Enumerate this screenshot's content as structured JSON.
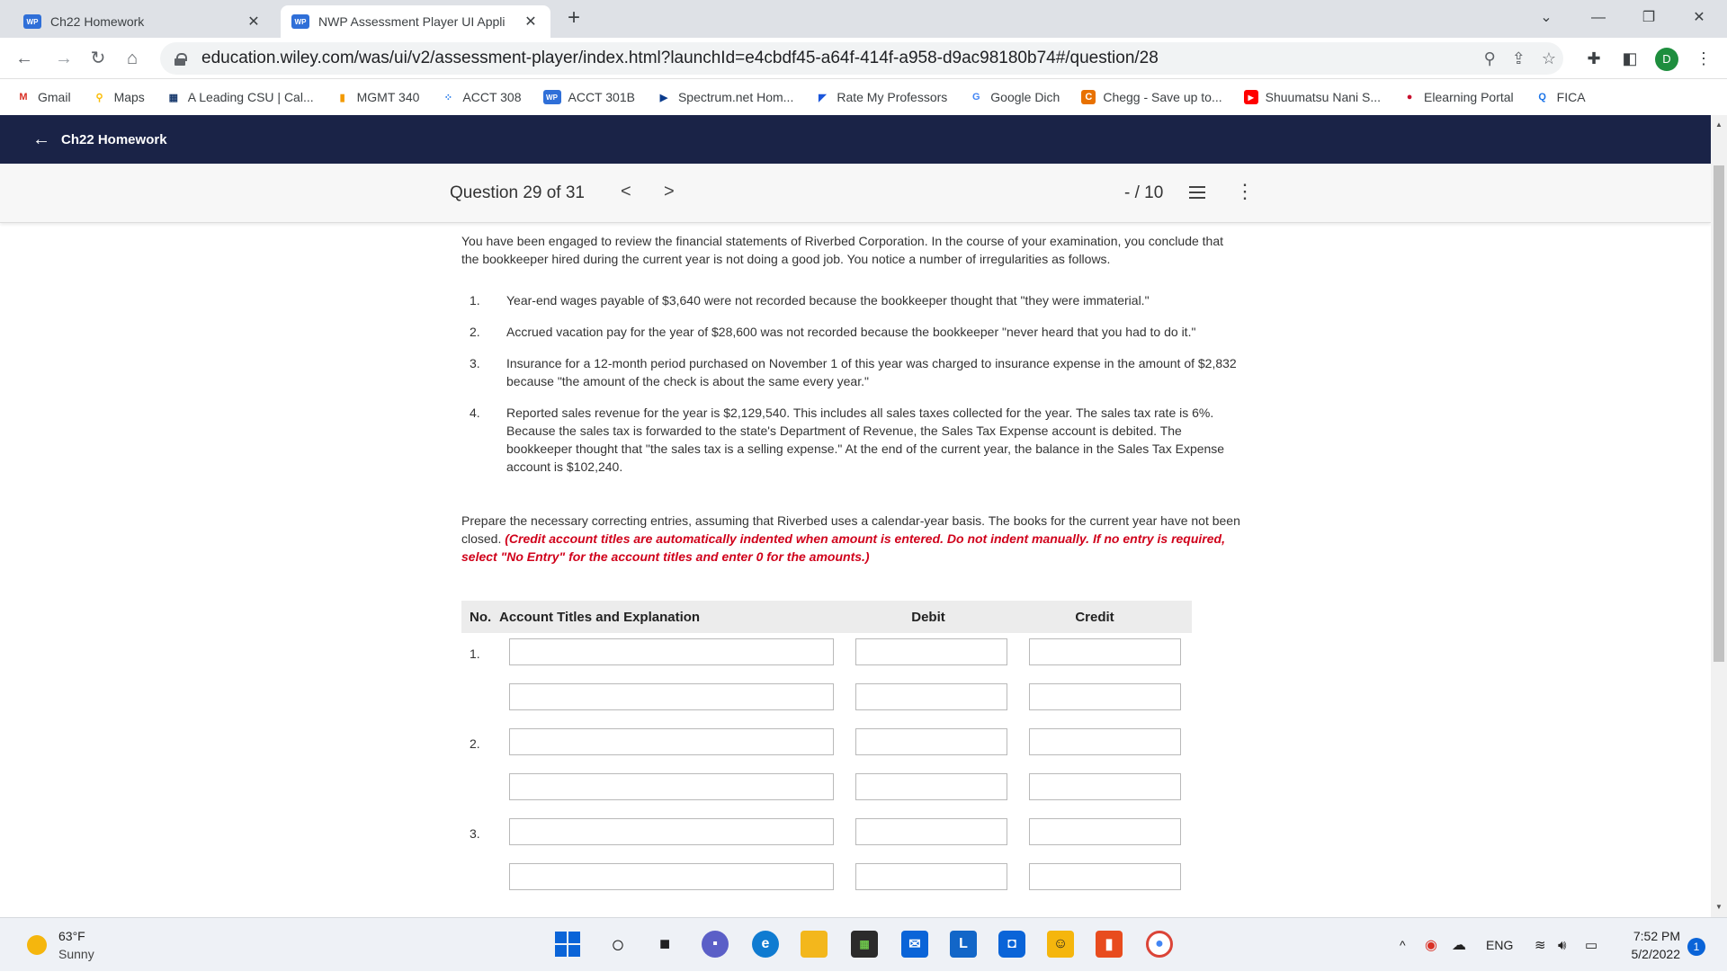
{
  "browser": {
    "tabs": [
      {
        "title": "Ch22 Homework",
        "favicon": "WP",
        "active": false
      },
      {
        "title": "NWP Assessment Player UI Appli",
        "favicon": "WP",
        "active": true
      }
    ],
    "url": "education.wiley.com/was/ui/v2/assessment-player/index.html?launchId=e4cbdf45-a64f-414f-a958-d9ac98180b74#/question/28",
    "profile_initial": "D",
    "bookmarks": [
      {
        "label": "Gmail",
        "icon": "gmail-icon",
        "color": "#d93025",
        "glyph": "M"
      },
      {
        "label": "Maps",
        "icon": "maps-pin-icon",
        "color": "#fbbc04",
        "glyph": "⚲"
      },
      {
        "label": "A Leading CSU | Cal...",
        "icon": "csu-icon",
        "color": "#1a3b6e",
        "glyph": "▦"
      },
      {
        "label": "MGMT 340",
        "icon": "bookmark-icon",
        "color": "#f29900",
        "glyph": "▮"
      },
      {
        "label": "ACCT 308",
        "icon": "dots-icon",
        "color": "#1a73e8",
        "glyph": "⁘"
      },
      {
        "label": "ACCT 301B",
        "icon": "wp-icon",
        "color": "#2f6fd8",
        "glyph": "WP"
      },
      {
        "label": "Spectrum.net Hom...",
        "icon": "play-icon",
        "color": "#0a3b8c",
        "glyph": "▶"
      },
      {
        "label": "Rate My Professors",
        "icon": "rmp-icon",
        "color": "#1a56db",
        "glyph": "◤"
      },
      {
        "label": "Google Dich",
        "icon": "translate-icon",
        "color": "#4285f4",
        "glyph": "G"
      },
      {
        "label": "Chegg - Save up to...",
        "icon": "chegg-icon",
        "color": "#e87100",
        "glyph": "C"
      },
      {
        "label": "Shuumatsu Nani S...",
        "icon": "youtube-icon",
        "color": "#ff0000",
        "glyph": "▶"
      },
      {
        "label": "Elearning Portal",
        "icon": "apple-icon",
        "color": "#c8102e",
        "glyph": "●"
      },
      {
        "label": "FICA",
        "icon": "search-q-icon",
        "color": "#1a73e8",
        "glyph": "Q"
      }
    ]
  },
  "app": {
    "back_label": "Ch22 Homework"
  },
  "question_bar": {
    "label": "Question 29 of 31",
    "prev": "<",
    "next": ">",
    "score": "- / 10"
  },
  "question": {
    "intro": "You have been engaged to review the financial statements of Riverbed Corporation. In the course of your examination, you conclude that the bookkeeper hired during the current year is not doing a good job. You notice a number of irregularities as follows.",
    "items": [
      {
        "num": "1.",
        "text": "Year-end wages payable of $3,640 were not recorded because the bookkeeper thought that \"they were immaterial.\""
      },
      {
        "num": "2.",
        "text": "Accrued vacation pay for the year of $28,600 was not recorded because the bookkeeper \"never heard that you had to do it.\""
      },
      {
        "num": "3.",
        "text": "Insurance for a 12-month period purchased on November 1 of this year was charged to insurance expense in the amount of $2,832 because \"the amount of the check is about the same every year.\""
      },
      {
        "num": "4.",
        "text": "Reported sales revenue for the year is $2,129,540. This includes all sales taxes collected for the year. The sales tax rate is 6%. Because the sales tax is forwarded to the state's Department of Revenue, the Sales Tax Expense account is debited. The bookkeeper thought that \"the sales tax is a selling expense.\" At the end of the current year, the balance in the Sales Tax Expense account is $102,240."
      }
    ],
    "prepare_text": "Prepare the necessary correcting entries, assuming that Riverbed uses a calendar-year basis. ",
    "prepare_bold": "The books for the current year have not been closed. ",
    "prepare_red": "(Credit account titles are automatically indented when amount is entered. Do not indent manually. If no entry is required, select \"No Entry\" for the account titles and enter 0 for the amounts.)"
  },
  "journal": {
    "headers": {
      "no": "No.",
      "account": "Account Titles and Explanation",
      "debit": "Debit",
      "credit": "Credit"
    },
    "rows": [
      {
        "no": "1."
      },
      {
        "no": ""
      },
      {
        "no": "2."
      },
      {
        "no": ""
      },
      {
        "no": "3."
      },
      {
        "no": ""
      }
    ]
  },
  "taskbar": {
    "temperature": "63°F",
    "weather": "Sunny",
    "language": "ENG",
    "time": "7:52 PM",
    "date": "5/2/2022",
    "notifications": "1"
  }
}
